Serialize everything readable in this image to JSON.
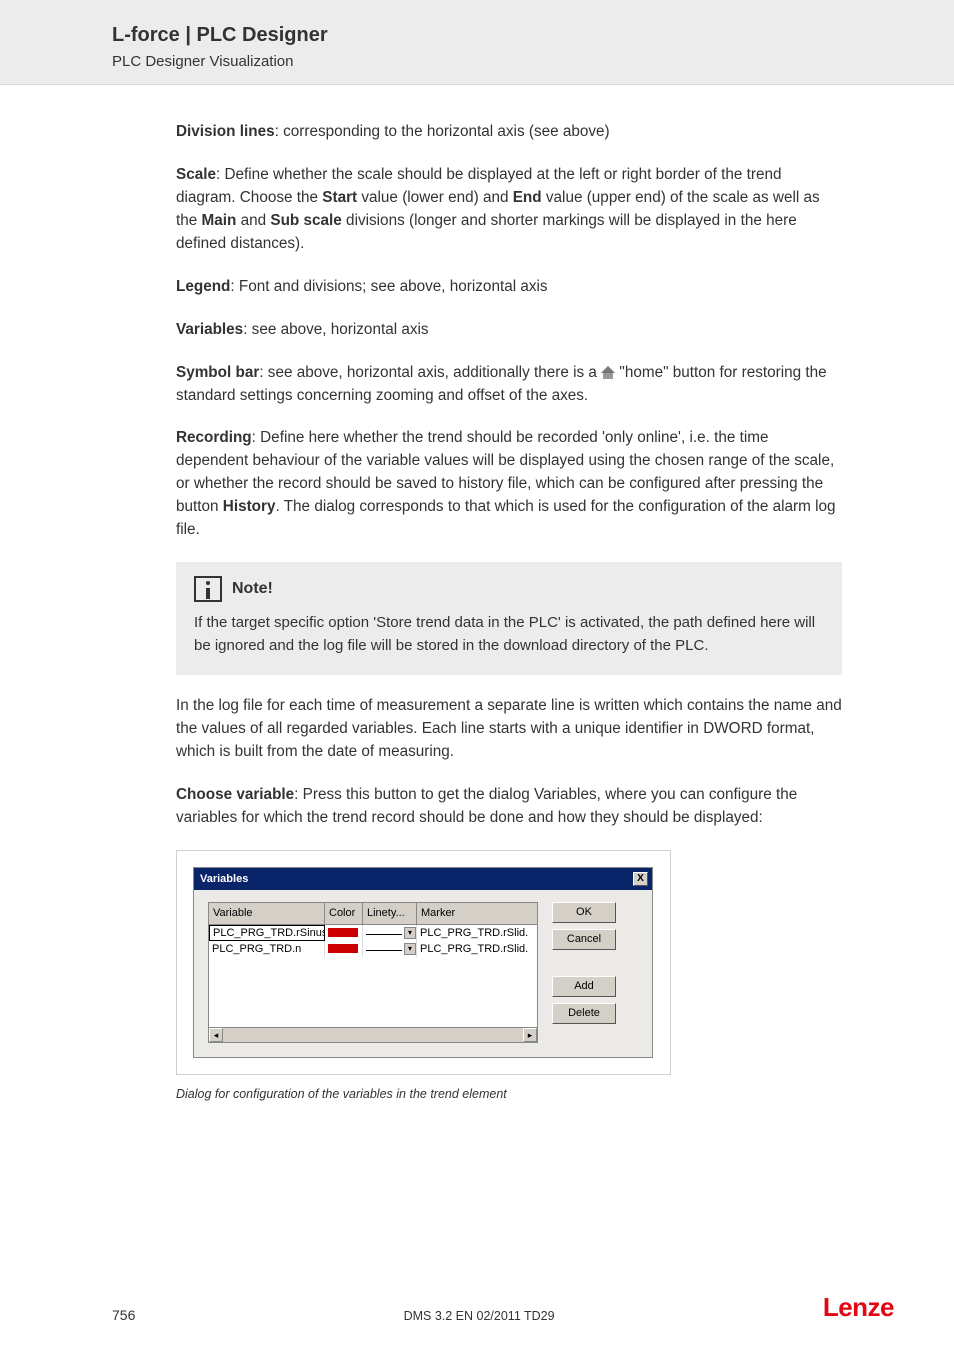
{
  "header": {
    "title": "L-force | PLC Designer",
    "subtitle": "PLC Designer Visualization"
  },
  "body": {
    "division_lines_label": "Division lines",
    "division_lines_text": ": corresponding to the horizontal axis (see above)",
    "scale_label": "Scale",
    "scale_text_1": ": Define whether the scale should be displayed at the left or right border of the trend diagram. Choose the ",
    "scale_start": "Start",
    "scale_text_2": " value (lower end) and ",
    "scale_end": "End",
    "scale_text_3": " value  (upper end) of the scale as well as the ",
    "scale_main": "Main",
    "scale_text_4": " and ",
    "scale_sub": "Sub scale",
    "scale_text_5": " divisions (longer and shorter markings will be displayed in the here defined distances).",
    "legend_label": "Legend",
    "legend_text": ": Font and divisions; see above, horizontal axis",
    "variables_label": "Variables",
    "variables_text": ": see above, horizontal axis",
    "symbol_label": "Symbol bar",
    "symbol_text_1": ": see above, horizontal axis, additionally there is a ",
    "symbol_text_2": " \"home\" button for restoring the standard settings concerning zooming and offset of the axes.",
    "recording_label": "Recording",
    "recording_text_1": ": Define here whether the trend should be recorded 'only online', i.e. the time dependent behaviour of the variable values will be displayed using the chosen range of the scale, or whether the record should be saved to history file, which can be configured after pressing the button ",
    "recording_history": "History",
    "recording_text_2": ". The dialog corresponds to that which is used for the configuration of the alarm log file.",
    "note_title": "Note!",
    "note_text": "If the target specific option 'Store trend data in the PLC' is activated, the path defined here will be ignored and the log file will be stored in the download directory of the PLC.",
    "logfile_text": "In the log file for each time of measurement a separate line is written which contains the name and the values of all regarded variables. Each line starts with a unique identifier in DWORD format, which is built from the date of measuring.",
    "choose_label": "Choose variable",
    "choose_text": ": Press this button to get the dialog Variables, where you can configure the variables for which the trend record should be done and how they should be displayed:",
    "caption": "Dialog for configuration of the variables in the trend element"
  },
  "dialog": {
    "title": "Variables",
    "close": "X",
    "columns": {
      "c1": "Variable",
      "c2": "Color",
      "c3": "Linety...",
      "c4": "Marker"
    },
    "rows": [
      {
        "var": "PLC_PRG_TRD.rSinus",
        "marker": "PLC_PRG_TRD.rSlid."
      },
      {
        "var": "PLC_PRG_TRD.n",
        "marker": "PLC_PRG_TRD.rSlid."
      }
    ],
    "buttons": {
      "ok": "OK",
      "cancel": "Cancel",
      "add": "Add",
      "delete": "Delete"
    }
  },
  "footer": {
    "page": "756",
    "docid": "DMS 3.2 EN 02/2011 TD29",
    "logo": "Lenze"
  }
}
